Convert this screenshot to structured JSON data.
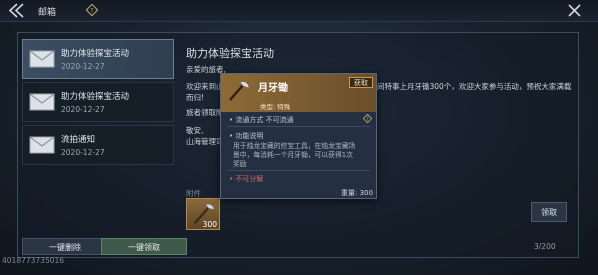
{
  "header": {
    "title": "邮箱"
  },
  "mail_list": [
    {
      "title": "助力体验探宝活动",
      "date": "2020-12-27",
      "active": true
    },
    {
      "title": "助力体验探宝活动",
      "date": "2020-12-27",
      "active": false
    },
    {
      "title": "流拍通知",
      "date": "2020-12-27",
      "active": false
    }
  ],
  "footer": {
    "delete_all_label": "一键删除",
    "claim_all_label": "一键领取",
    "count": "3/200",
    "uid": "4018773735016"
  },
  "mail": {
    "title": "助力体验探宝活动",
    "greeting": "亲爱的旅者,",
    "body_line1a": "欢迎来到山",
    "body_line1b": "而归!",
    "body_line1c": "间特事上月牙锄300个，欢迎大家参与活动，预祝大家满载",
    "body_line2": "旅者领取附",
    "body_line3": "敬安,",
    "body_line4": "山海管理司",
    "attachment_label": "附件",
    "attachment_qty": "300",
    "claim_label": "领取"
  },
  "tooltip": {
    "item_name": "月牙锄",
    "get_label": "获取",
    "type_line": "类型: 特殊",
    "flow_line": "• 流通方式   不可流通",
    "func_title": "• 功能说明",
    "func_desc_1": "用于烛龙宝藏的挖宝工具，在烛龙宝藏场",
    "func_desc_2": "景中，每消耗一个月牙锄，可以获得1次",
    "func_desc_3": "奖励",
    "no_split": "• 不可分解",
    "weight": "重量: 300"
  },
  "colors": {
    "accent_gold": "#8d6a37",
    "claim_green": "#3e5a4a",
    "warn_red": "#d36a6a"
  }
}
